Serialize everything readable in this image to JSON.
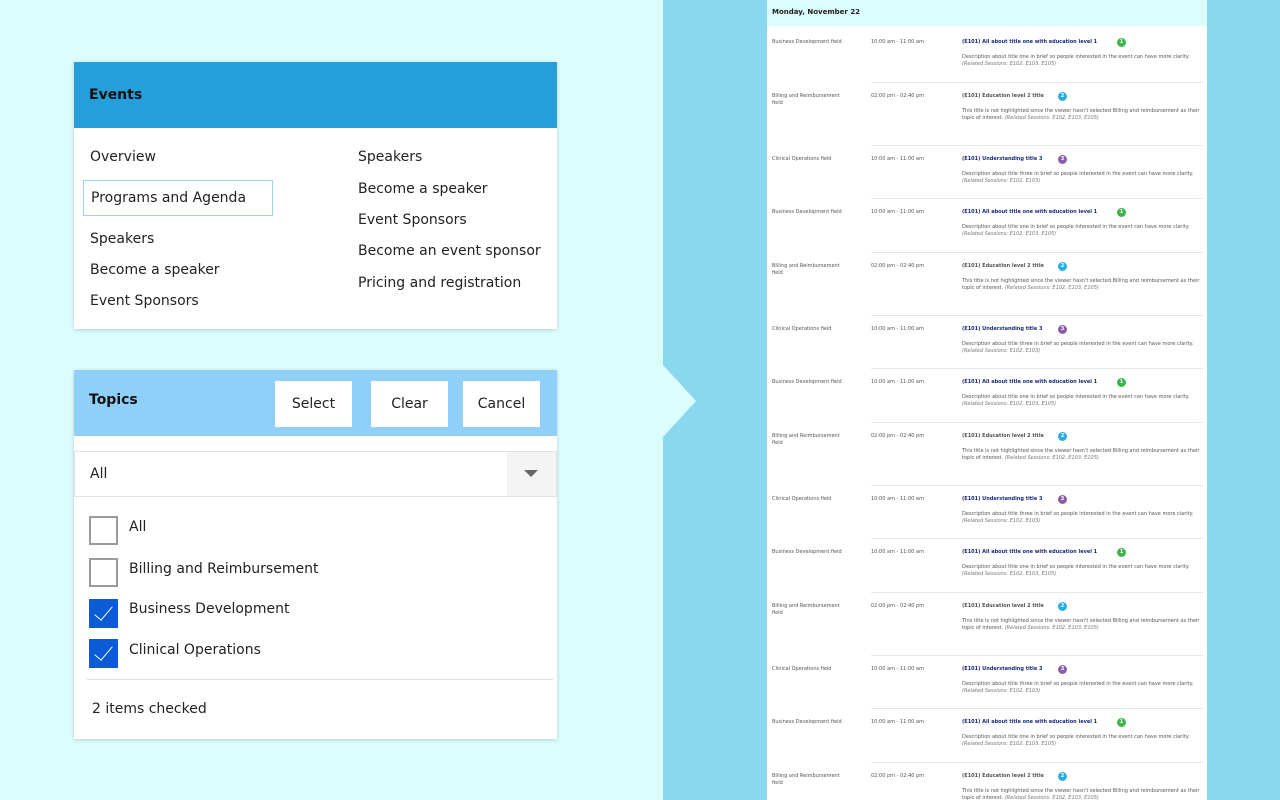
{
  "events": {
    "title": "Events",
    "left_links": [
      "Overview",
      "Programs and Agenda",
      "Speakers",
      "Become a speaker",
      "Event Sponsors"
    ],
    "right_links": [
      "Speakers",
      "Become a speaker",
      "Event Sponsors",
      "Become an event sponsor",
      "Pricing and registration"
    ],
    "selected": "Programs and Agenda"
  },
  "topics": {
    "title": "Topics",
    "select_label": "Select",
    "clear_label": "Clear",
    "cancel_label": "Cancel",
    "dropdown_value": "All",
    "options": [
      {
        "label": "All",
        "checked": false
      },
      {
        "label": "Billing and Reimbursement",
        "checked": false
      },
      {
        "label": "Business Development",
        "checked": true
      },
      {
        "label": "Clinical Operations",
        "checked": true
      }
    ],
    "status": "2 items checked"
  },
  "agenda": {
    "date": "Monday, November 22",
    "session_types": {
      "business": {
        "field": "Business Development field",
        "time": "10:00 am - 11:00 am",
        "title": "(E101) All about title one with education level 1",
        "badge": "1",
        "badge_color": "#3cb54a",
        "highlighted": true,
        "desc": "Description about title one in brief so people interested in the event can have more clarity.",
        "related": "(Related Sessions: E102, E103, E105)"
      },
      "billing": {
        "field": "Billing and Reimbursement field",
        "time": "02:00 pm - 02:40 pm",
        "title": "(E101) Education level 2 title",
        "badge": "2",
        "badge_color": "#29aee0",
        "highlighted": false,
        "desc": "This title is not highlighted since the viewer hasn't selected Billing and reimbursement as their topic of interest.",
        "related": "(Related Sessions: E102, E103, E105)"
      },
      "clinical": {
        "field": "Clinical Operations field",
        "time": "10:00 am - 11:00 am",
        "title": "(E101) Understanding title 3",
        "badge": "3",
        "badge_color": "#8c5ea8",
        "highlighted": true,
        "desc": "Description about title three in brief so people interested in the event can have more clarity.",
        "related": "(Related Sessions: E102, E103)"
      }
    },
    "sessions": [
      "business",
      "billing",
      "clinical",
      "business",
      "billing",
      "clinical",
      "business",
      "billing",
      "clinical",
      "business",
      "billing",
      "clinical",
      "business",
      "billing"
    ]
  }
}
